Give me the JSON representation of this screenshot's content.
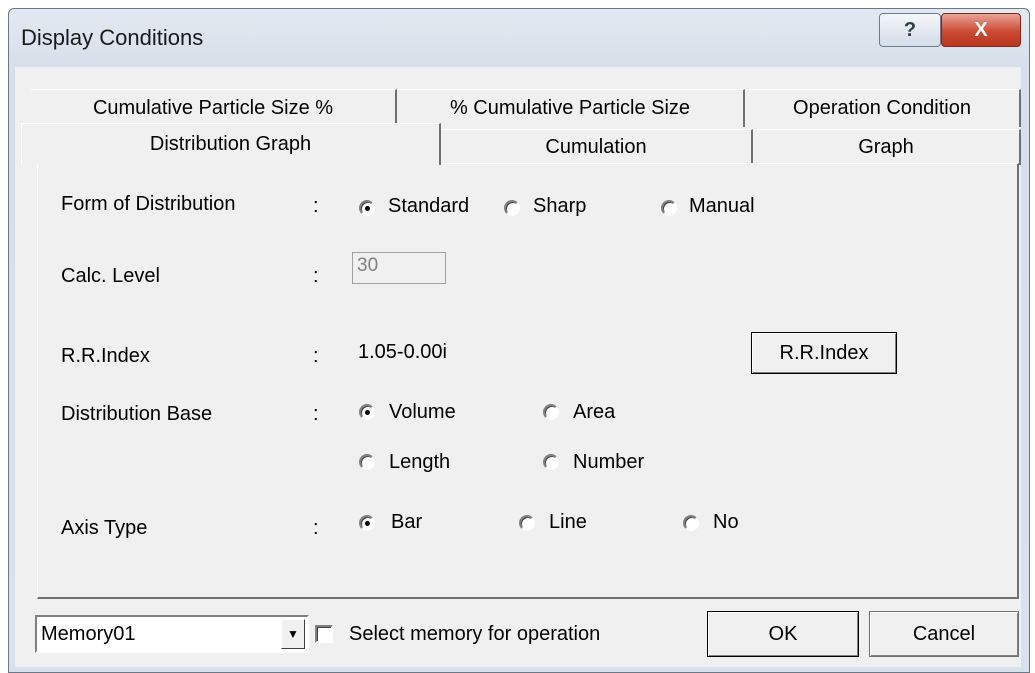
{
  "window": {
    "title": "Display Conditions",
    "help_icon": "question-mark-icon",
    "help_glyph": "?",
    "close_icon": "close-icon",
    "close_glyph": "X"
  },
  "tabs": {
    "back": [
      "Cumulative Particle Size %",
      "% Cumulative Particle Size",
      "Operation Condition"
    ],
    "front": [
      "Distribution Graph",
      "Cumulation",
      "Graph"
    ],
    "active": "Distribution Graph"
  },
  "form": {
    "separator": ":",
    "distribution_form": {
      "label": "Form of Distribution",
      "options": [
        "Standard",
        "Sharp",
        "Manual"
      ],
      "selected": "Standard"
    },
    "calc_level": {
      "label": "Calc. Level",
      "value": "30"
    },
    "rr_index": {
      "label": "R.R.Index",
      "value": "1.05-0.00i",
      "button_label": "R.R.Index"
    },
    "distribution_base": {
      "label": "Distribution Base",
      "options": [
        "Volume",
        "Area",
        "Length",
        "Number"
      ],
      "selected": "Volume"
    },
    "axis_type": {
      "label": "Axis Type",
      "options": [
        "Bar",
        "Line",
        "No"
      ],
      "selected": "Bar"
    }
  },
  "footer": {
    "memory_value": "Memory01",
    "dropdown_icon": "chevron-down-icon",
    "dropdown_glyph": "▼",
    "select_memory_label": "Select memory for operation",
    "select_memory_checked": false,
    "ok_label": "OK",
    "cancel_label": "Cancel"
  }
}
